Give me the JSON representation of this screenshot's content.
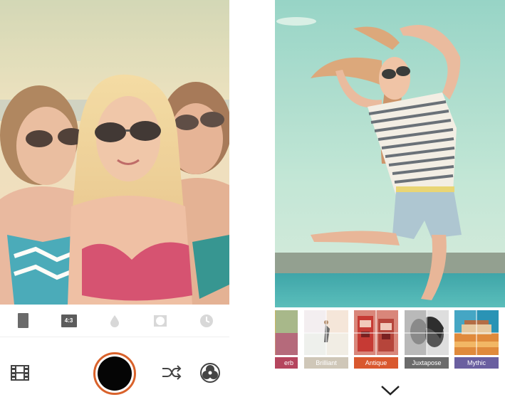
{
  "camera_screen": {
    "formats": [
      {
        "name": "portrait",
        "label": ""
      },
      {
        "name": "ratio-4-3",
        "label": "4:3"
      },
      {
        "name": "drop",
        "label": ""
      },
      {
        "name": "vignette",
        "label": ""
      },
      {
        "name": "timer",
        "label": ""
      }
    ],
    "controls": {
      "gallery_icon": "film-strip-icon",
      "shutter_ring_color": "#d9622b",
      "shuffle_icon": "shuffle-icon",
      "filters_icon": "color-filters-icon"
    }
  },
  "edit_screen": {
    "filters": [
      {
        "label": "erb",
        "color": "#b5455e"
      },
      {
        "label": "Brilliant",
        "color": "#cfc7b8"
      },
      {
        "label": "Antique",
        "color": "#d9582e"
      },
      {
        "label": "Juxtapose",
        "color": "#6b6b6b"
      },
      {
        "label": "Mythic",
        "color": "#6a5fa0"
      }
    ],
    "collapse_icon": "chevron-down-icon"
  }
}
